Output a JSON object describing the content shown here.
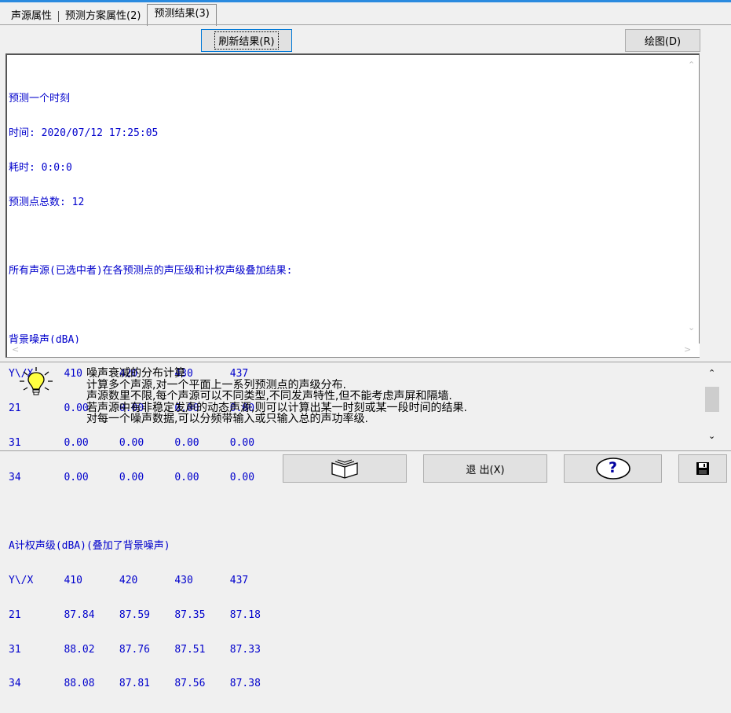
{
  "tabs": [
    {
      "label": "声源属性"
    },
    {
      "label": "预测方案属性(2)"
    },
    {
      "label": "预测结果(3)",
      "active": true
    }
  ],
  "toolbar": {
    "refresh_label": "刷新结果(R)",
    "draw_label": "绘图(D)"
  },
  "results": {
    "lines": [
      "预测一个时刻",
      "时间: 2020/07/12 17:25:05",
      "耗时: 0:0:0",
      "预测点总数: 12",
      "",
      "所有声源(已选中者)在各预测点的声压级和计权声级叠加结果:",
      "",
      "背景噪声(dBA)",
      "Y\\/X     410      420      430      437",
      "21       0.00     0.00     0.00     0.00",
      "31       0.00     0.00     0.00     0.00",
      "34       0.00     0.00     0.00     0.00",
      "",
      "A计权声级(dBA)(叠加了背景噪声)",
      "Y\\/X     410      420      430      437",
      "21       87.84    87.59    87.35    87.18",
      "31       88.02    87.76    87.51    87.33",
      "34       88.08    87.81    87.56    87.38"
    ]
  },
  "info": {
    "lines": [
      "噪声衰减的分布计算",
      "计算多个声源,对一个平面上一系列预测点的声级分布.",
      "声源数里不限,每个声源可以不同类型,不同发声特性,但不能考虑声屏和隔墙.",
      "若声源中有非稳定发声的动态声源,则可以计算出某一时刻或某一段时间的结果.",
      "对每一个噪声数据,可以分频带输入或只输入总的声功率级."
    ]
  },
  "bottom": {
    "exit_label": "退 出(X)",
    "help_label": "?"
  },
  "icons": {
    "bulb": "lightbulb-icon",
    "book": "book-icon",
    "help": "help-icon",
    "save": "floppy-icon"
  }
}
